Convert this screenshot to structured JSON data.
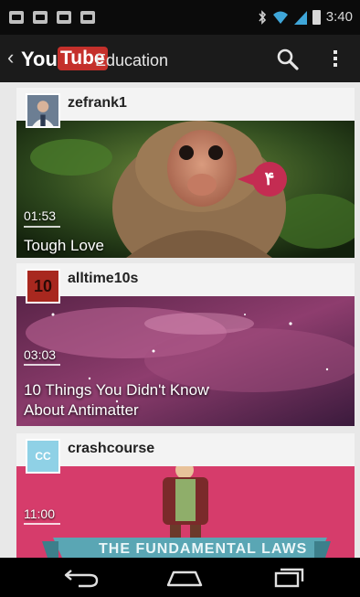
{
  "status_bar": {
    "time": "3:40",
    "icons": [
      "chat-notification-icon",
      "sim-notification-icon",
      "photo-notification-icon",
      "gamepad-notification-icon",
      "bluetooth-icon",
      "wifi-icon",
      "signal-icon",
      "battery-icon"
    ]
  },
  "action_bar": {
    "logo_you": "You",
    "logo_tube": "Tube",
    "title": "Education",
    "icons": [
      "up-caret-icon",
      "search-icon",
      "overflow-menu-icon"
    ]
  },
  "feed": {
    "items": [
      {
        "channel": "zefrank1",
        "duration": "01:53",
        "title": "Tough Love",
        "badge": "۴"
      },
      {
        "channel": "alltime10s",
        "avatar_text": "10",
        "duration": "03:03",
        "title_line1": "10 Things You Didn't Know",
        "title_line2": "About Antimatter"
      },
      {
        "channel": "crashcourse",
        "avatar_text": "CC",
        "duration": "11:00",
        "banner": "THE FUNDAMENTAL LAWS"
      }
    ]
  },
  "nav_bar": {
    "icons": [
      "back-icon",
      "home-icon",
      "recent-apps-icon"
    ]
  },
  "colors": {
    "youtube_red": "#c4302b",
    "badge": "#c42c52",
    "crashcourse_pink": "#d63c6b",
    "banner_teal": "#5aa6b4"
  }
}
